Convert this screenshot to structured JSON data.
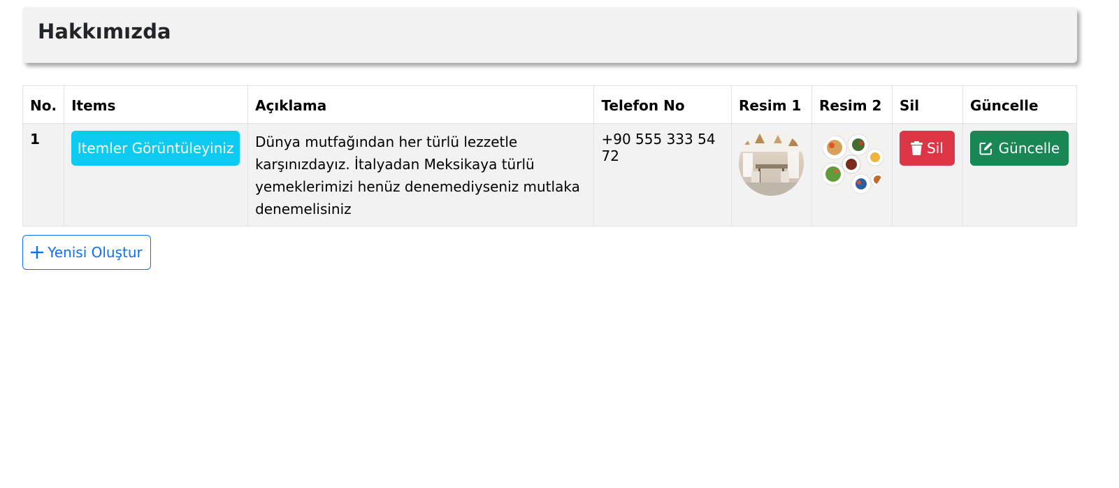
{
  "header": {
    "title": "Hakkımızda"
  },
  "table": {
    "columns": [
      "No.",
      "Items",
      "Açıklama",
      "Telefon No",
      "Resim 1",
      "Resim 2",
      "Sil",
      "Güncelle"
    ],
    "rows": [
      {
        "no": "1",
        "items_button": "Itemler Görüntüleyiniz",
        "description": "Dünya mutfağından her türlü lezzetle karşınızdayız. İtalyadan Meksikaya türlü yemeklerimizi henüz denemediyseniz mutlaka denemelisiniz",
        "phone": "+90 555 333 54 72",
        "image1_icon": "restaurant-interior-image",
        "image2_icon": "food-plates-image",
        "delete_label": "Sil",
        "delete_icon": "trash-icon",
        "update_label": "Güncelle",
        "update_icon": "edit-icon"
      }
    ]
  },
  "create_button": {
    "label": "Yenisi Oluştur",
    "icon": "plus-icon"
  },
  "colors": {
    "info": "#0dcaf0",
    "danger": "#dc3545",
    "success": "#198754",
    "primary": "#0d6efd",
    "header_bg": "#f2f2f2"
  }
}
